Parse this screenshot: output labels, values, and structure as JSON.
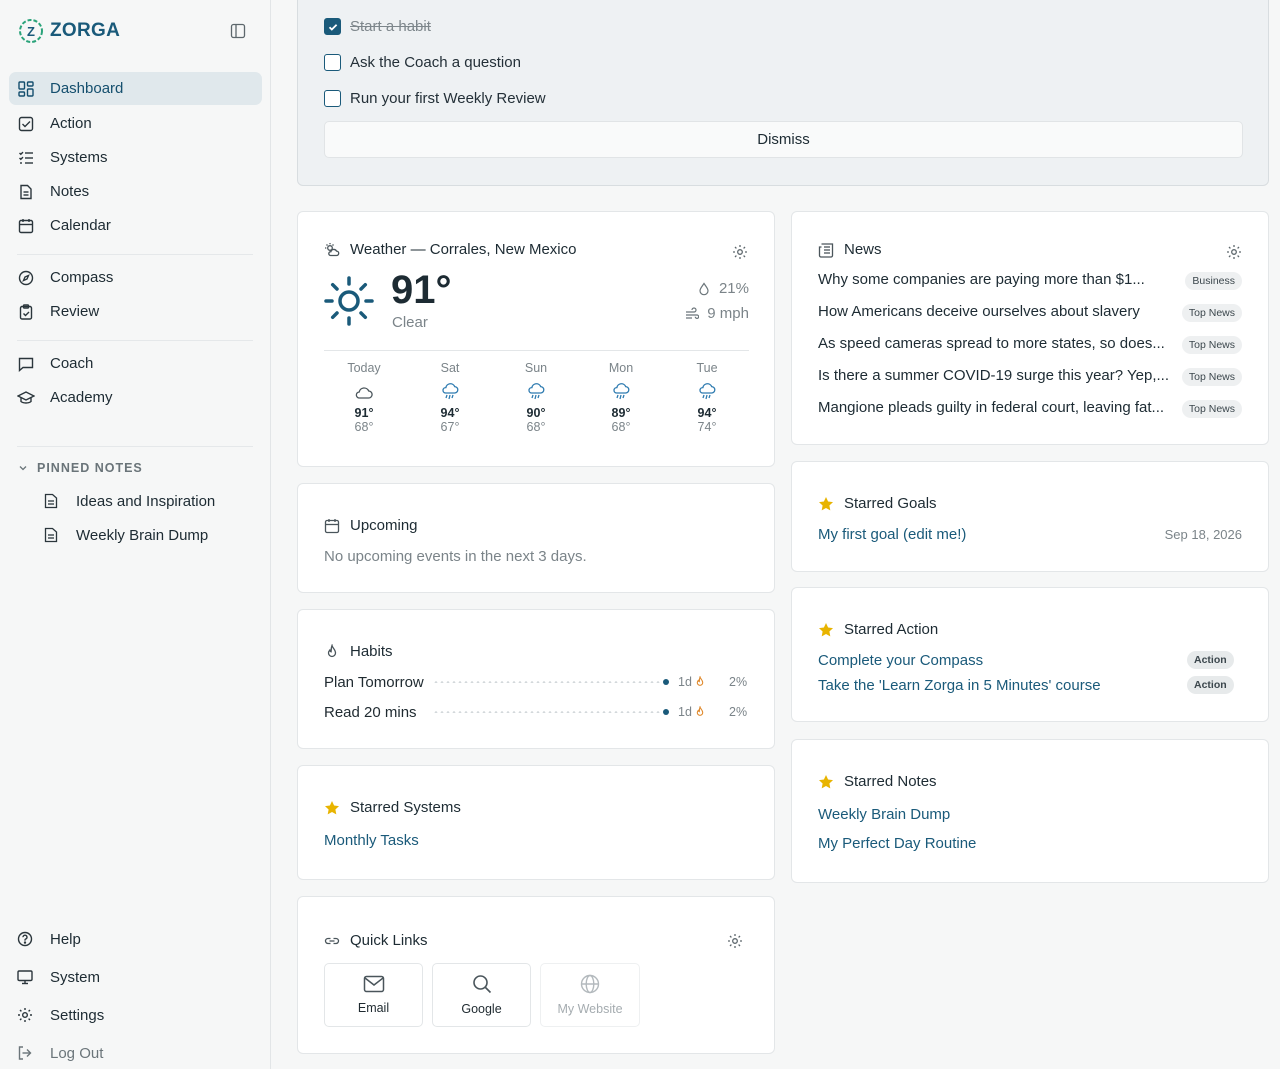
{
  "brand": {
    "name": "ZORGA"
  },
  "sidebar": {
    "nav": [
      {
        "label": "Dashboard",
        "icon": "dashboard-icon",
        "active": true
      },
      {
        "label": "Action",
        "icon": "check-square-icon"
      },
      {
        "label": "Systems",
        "icon": "list-check-icon"
      },
      {
        "label": "Notes",
        "icon": "document-icon"
      },
      {
        "label": "Calendar",
        "icon": "calendar-icon"
      },
      {
        "label": "Compass",
        "icon": "compass-icon"
      },
      {
        "label": "Review",
        "icon": "clipboard-check-icon"
      },
      {
        "label": "Coach",
        "icon": "chat-icon"
      },
      {
        "label": "Academy",
        "icon": "graduation-cap-icon"
      }
    ],
    "pinned_header": "PINNED NOTES",
    "pinned": [
      "Ideas and Inspiration",
      "Weekly Brain Dump"
    ],
    "bottom": [
      {
        "label": "Help",
        "icon": "help-icon"
      },
      {
        "label": "System",
        "icon": "monitor-icon"
      },
      {
        "label": "Settings",
        "icon": "gear-icon"
      },
      {
        "label": "Log Out",
        "icon": "logout-icon"
      }
    ]
  },
  "onboarding": {
    "items": [
      {
        "label": "Start a habit",
        "checked": true
      },
      {
        "label": "Ask the Coach a question",
        "checked": false
      },
      {
        "label": "Run your first Weekly Review",
        "checked": false
      }
    ],
    "dismiss": "Dismiss"
  },
  "weather": {
    "title": "Weather — Corrales, New Mexico",
    "temp": "91°",
    "condition": "Clear",
    "humidity": "21%",
    "wind": "9 mph",
    "forecast": [
      {
        "day": "Today",
        "icon": "cloud-icon",
        "high": "91°",
        "low": "68°"
      },
      {
        "day": "Sat",
        "icon": "rain-icon",
        "high": "94°",
        "low": "67°"
      },
      {
        "day": "Sun",
        "icon": "rain-icon",
        "high": "90°",
        "low": "68°"
      },
      {
        "day": "Mon",
        "icon": "rain-icon",
        "high": "89°",
        "low": "68°"
      },
      {
        "day": "Tue",
        "icon": "rain-icon",
        "high": "94°",
        "low": "74°"
      }
    ]
  },
  "news": {
    "title": "News",
    "items": [
      {
        "headline": "Why some companies are paying more than $1...",
        "tag": "Business"
      },
      {
        "headline": "How Americans deceive ourselves about slavery",
        "tag": "Top News"
      },
      {
        "headline": "As speed cameras spread to more states, so does...",
        "tag": "Top News"
      },
      {
        "headline": "Is there a summer COVID-19 surge this year? Yep,...",
        "tag": "Top News"
      },
      {
        "headline": "Mangione pleads guilty in federal court, leaving fat...",
        "tag": "Top News"
      }
    ]
  },
  "upcoming": {
    "title": "Upcoming",
    "empty": "No upcoming events in the next 3 days."
  },
  "habits": {
    "title": "Habits",
    "items": [
      {
        "name": "Plan Tomorrow",
        "streak": "1d",
        "percent": "2%"
      },
      {
        "name": "Read 20 mins",
        "streak": "1d",
        "percent": "2%"
      }
    ]
  },
  "starred_systems": {
    "title": "Starred Systems",
    "items": [
      "Monthly Tasks"
    ]
  },
  "quick_links": {
    "title": "Quick Links",
    "items": [
      {
        "label": "Email",
        "icon": "mail-icon"
      },
      {
        "label": "Google",
        "icon": "search-icon"
      },
      {
        "label": "My Website",
        "icon": "globe-icon"
      }
    ]
  },
  "starred_goals": {
    "title": "Starred Goals",
    "items": [
      {
        "label": "My first goal (edit me!)",
        "date": "Sep 18, 2026"
      }
    ]
  },
  "starred_action": {
    "title": "Starred Action",
    "items": [
      {
        "label": "Complete your Compass",
        "tag": "Action"
      },
      {
        "label": "Take the 'Learn Zorga in 5 Minutes' course",
        "tag": "Action"
      }
    ]
  },
  "starred_notes": {
    "title": "Starred Notes",
    "items": [
      "Weekly Brain Dump",
      "My Perfect Day Routine"
    ]
  },
  "colors": {
    "accent": "#1a5a7a",
    "star": "#e8b400",
    "background": "#f6f7f7"
  }
}
